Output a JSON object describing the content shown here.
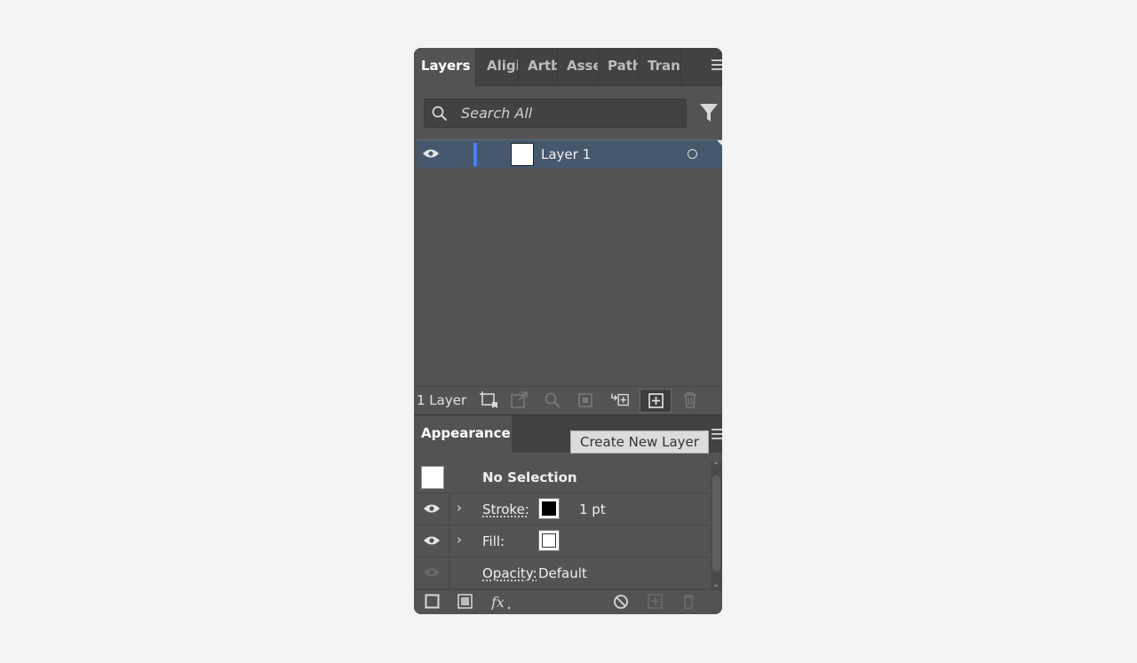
{
  "tabs": [
    {
      "label": "Layers",
      "active": true
    },
    {
      "label": "Aligi"
    },
    {
      "label": "Artb"
    },
    {
      "label": "Asse"
    },
    {
      "label": "Path"
    },
    {
      "label": "Tran"
    }
  ],
  "search": {
    "placeholder": "Search All"
  },
  "layers": [
    {
      "name": "Layer 1",
      "color": "#4f7cf0"
    }
  ],
  "layers_footer": {
    "count_label": "1 Layer"
  },
  "tooltip": "Create New Layer",
  "appearance": {
    "tab_label": "Appearance",
    "no_selection": "No Selection",
    "stroke_label": "Stroke:",
    "stroke_value": "1 pt",
    "fill_label": "Fill:",
    "opacity_label": "Opacity:",
    "opacity_value": "Default"
  },
  "colors": {
    "panel_bg": "#535353",
    "selected_row": "#46586d",
    "layer_color": "#4f7cf0"
  }
}
